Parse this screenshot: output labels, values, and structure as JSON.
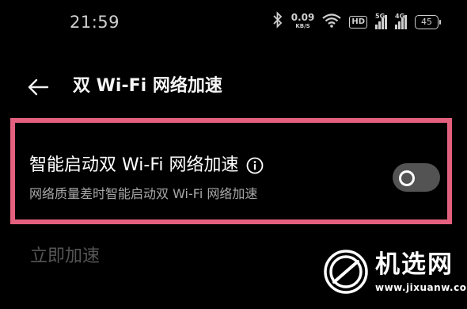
{
  "status_bar": {
    "time": "21:59",
    "net_speed_value": "0.09",
    "net_speed_unit": "KB/S",
    "hd_label": "HD",
    "sim1_label": "5G",
    "sim2_label": "4G",
    "battery_level": "45",
    "icons": [
      "bluetooth-icon",
      "wifi-icon",
      "signal-icon",
      "battery-icon"
    ]
  },
  "header": {
    "title": "双 Wi-Fi 网络加速",
    "back_icon": "back-arrow-icon"
  },
  "setting": {
    "title": "智能启动双 Wi-Fi 网络加速",
    "subtitle": "网络质量差时智能启动双 Wi-Fi 网络加速",
    "toggle_state": "off",
    "highlight_color": "#e4607f"
  },
  "accelerate_now": {
    "label": "立即加速",
    "enabled": false
  },
  "watermark": {
    "text": "机选网",
    "url": "www.jixuanw.com"
  }
}
